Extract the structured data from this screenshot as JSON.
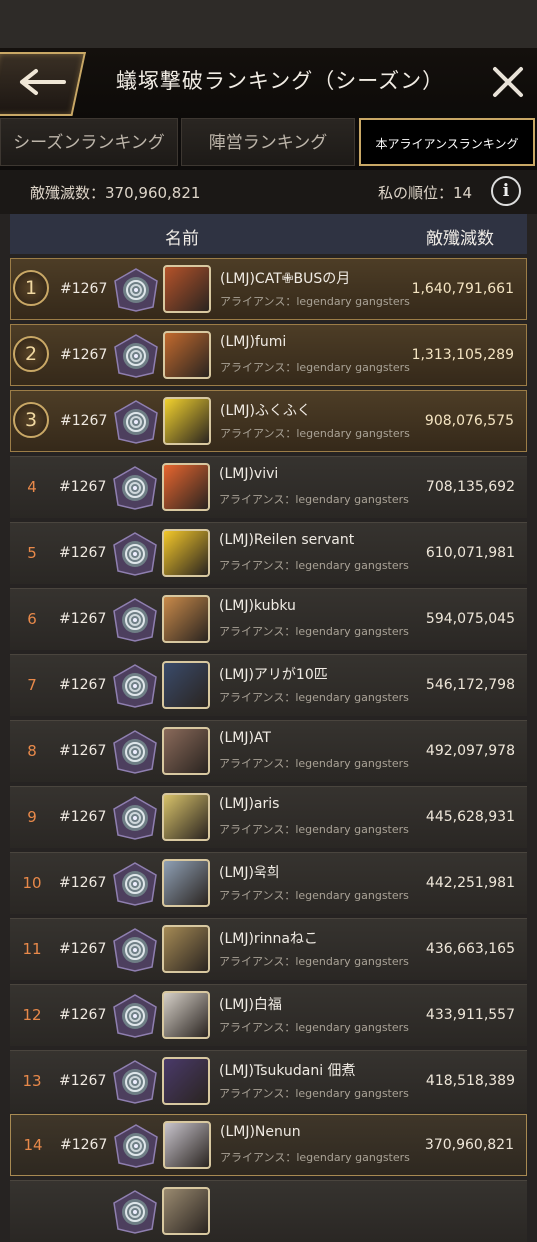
{
  "header": {
    "title": "蟻塚撃破ランキング（シーズン）"
  },
  "tabs": [
    {
      "label": "シーズンランキング",
      "active": false
    },
    {
      "label": "陣営ランキング",
      "active": false
    },
    {
      "label": "本アライアンスランキング",
      "active": true
    }
  ],
  "summary": {
    "total_label": "敵殲滅数：370,960,821",
    "my_rank_label": "私の順位：14"
  },
  "columns": {
    "name": "名前",
    "kills": "敵殲滅数"
  },
  "rows": [
    {
      "rank": "1",
      "server": "#1267",
      "name": "(LMJ)CAT✙BUSの月",
      "alliance": "アライアンス：legendary gangsters",
      "kills": "1,640,791,661",
      "avatar_color": "#b5532a"
    },
    {
      "rank": "2",
      "server": "#1267",
      "name": "(LMJ)fumi",
      "alliance": "アライアンス：legendary gangsters",
      "kills": "1,313,105,289",
      "avatar_color": "#c26a2e"
    },
    {
      "rank": "3",
      "server": "#1267",
      "name": "(LMJ)ふくふく",
      "alliance": "アライアンス：legendary gangsters",
      "kills": "908,076,575",
      "avatar_color": "#f2d22e"
    },
    {
      "rank": "4",
      "server": "#1267",
      "name": "(LMJ)vivi",
      "alliance": "アライアンス：legendary gangsters",
      "kills": "708,135,692",
      "avatar_color": "#e8662f"
    },
    {
      "rank": "5",
      "server": "#1267",
      "name": "(LMJ)Reilen servant",
      "alliance": "アライアンス：legendary gangsters",
      "kills": "610,071,981",
      "avatar_color": "#f4c82a"
    },
    {
      "rank": "6",
      "server": "#1267",
      "name": "(LMJ)kubku",
      "alliance": "アライアンス：legendary gangsters",
      "kills": "594,075,045",
      "avatar_color": "#c98a4a"
    },
    {
      "rank": "7",
      "server": "#1267",
      "name": "(LMJ)アリが10匹",
      "alliance": "アライアンス：legendary gangsters",
      "kills": "546,172,798",
      "avatar_color": "#3a4b6b"
    },
    {
      "rank": "8",
      "server": "#1267",
      "name": "(LMJ)AT",
      "alliance": "アライアンス：legendary gangsters",
      "kills": "492,097,978",
      "avatar_color": "#8a6a5a"
    },
    {
      "rank": "9",
      "server": "#1267",
      "name": "(LMJ)aris",
      "alliance": "アライアンス：legendary gangsters",
      "kills": "445,628,931",
      "avatar_color": "#d8c26a"
    },
    {
      "rank": "10",
      "server": "#1267",
      "name": "(LMJ)욱희",
      "alliance": "アライアンス：legendary gangsters",
      "kills": "442,251,981",
      "avatar_color": "#8fa0b5"
    },
    {
      "rank": "11",
      "server": "#1267",
      "name": "(LMJ)rinnaねこ",
      "alliance": "アライアンス：legendary gangsters",
      "kills": "436,663,165",
      "avatar_color": "#a58a55"
    },
    {
      "rank": "12",
      "server": "#1267",
      "name": "(LMJ)白福",
      "alliance": "アライアンス：legendary gangsters",
      "kills": "433,911,557",
      "avatar_color": "#d6d0c8"
    },
    {
      "rank": "13",
      "server": "#1267",
      "name": "(LMJ)Tsukudani 佃煮",
      "alliance": "アライアンス：legendary gangsters",
      "kills": "418,518,389",
      "avatar_color": "#4a3a6a"
    },
    {
      "rank": "14",
      "server": "#1267",
      "name": "(LMJ)Nenun",
      "alliance": "アライアンス：legendary gangsters",
      "kills": "370,960,821",
      "avatar_color": "#c8c4cc"
    },
    {
      "rank": "",
      "server": "",
      "name": "",
      "alliance": "",
      "kills": "",
      "avatar_color": "#9a8a70"
    }
  ]
}
